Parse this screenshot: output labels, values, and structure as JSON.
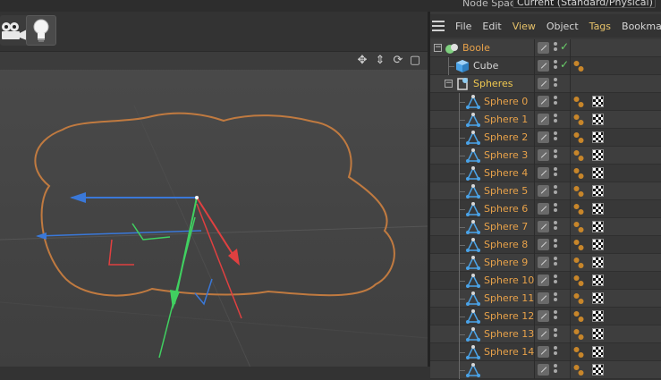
{
  "node_space": {
    "label": "Node Space:",
    "value": "Current (Standard/Physical)"
  },
  "toolbar": {
    "buttons": [
      {
        "icon": "camera-icon"
      },
      {
        "icon": "lightbulb-icon"
      }
    ]
  },
  "viewport": {
    "header_icons": [
      "move-view-icon",
      "dolly-view-icon",
      "rotate-view-icon",
      "maximize-view-icon"
    ]
  },
  "object_manager": {
    "menu": [
      "File",
      "Edit",
      "View",
      "Object",
      "Tags",
      "Bookmarks"
    ],
    "highlighted_menu": [
      "View",
      "Tags"
    ],
    "objects": [
      {
        "name": "Boole",
        "depth": 0,
        "type": "boole",
        "name_color": "#e8a24a",
        "checked": true,
        "material": false,
        "texture": false,
        "expanded": true
      },
      {
        "name": "Cube",
        "depth": 1,
        "type": "cube",
        "name_color": "#d6d6d6",
        "checked": true,
        "material": true,
        "texture": false
      },
      {
        "name": "Spheres",
        "depth": 1,
        "type": "null",
        "name_color": "#f0c850",
        "checked": false,
        "material": false,
        "texture": false,
        "expanded": true
      },
      {
        "name": "Sphere 0",
        "depth": 2,
        "type": "sphere",
        "name_color": "#e8a24a",
        "checked": false,
        "material": true,
        "texture": true
      },
      {
        "name": "Sphere 1",
        "depth": 2,
        "type": "sphere",
        "name_color": "#e8a24a",
        "checked": false,
        "material": true,
        "texture": true
      },
      {
        "name": "Sphere 2",
        "depth": 2,
        "type": "sphere",
        "name_color": "#e8a24a",
        "checked": false,
        "material": true,
        "texture": true
      },
      {
        "name": "Sphere 3",
        "depth": 2,
        "type": "sphere",
        "name_color": "#e8a24a",
        "checked": false,
        "material": true,
        "texture": true
      },
      {
        "name": "Sphere 4",
        "depth": 2,
        "type": "sphere",
        "name_color": "#e8a24a",
        "checked": false,
        "material": true,
        "texture": true
      },
      {
        "name": "Sphere 5",
        "depth": 2,
        "type": "sphere",
        "name_color": "#e8a24a",
        "checked": false,
        "material": true,
        "texture": true
      },
      {
        "name": "Sphere 6",
        "depth": 2,
        "type": "sphere",
        "name_color": "#e8a24a",
        "checked": false,
        "material": true,
        "texture": true
      },
      {
        "name": "Sphere 7",
        "depth": 2,
        "type": "sphere",
        "name_color": "#e8a24a",
        "checked": false,
        "material": true,
        "texture": true
      },
      {
        "name": "Sphere 8",
        "depth": 2,
        "type": "sphere",
        "name_color": "#e8a24a",
        "checked": false,
        "material": true,
        "texture": true
      },
      {
        "name": "Sphere 9",
        "depth": 2,
        "type": "sphere",
        "name_color": "#e8a24a",
        "checked": false,
        "material": true,
        "texture": true
      },
      {
        "name": "Sphere 10",
        "depth": 2,
        "type": "sphere",
        "name_color": "#e8a24a",
        "checked": false,
        "material": true,
        "texture": true
      },
      {
        "name": "Sphere 11",
        "depth": 2,
        "type": "sphere",
        "name_color": "#e8a24a",
        "checked": false,
        "material": true,
        "texture": true
      },
      {
        "name": "Sphere 12",
        "depth": 2,
        "type": "sphere",
        "name_color": "#e8a24a",
        "checked": false,
        "material": true,
        "texture": true
      },
      {
        "name": "Sphere 13",
        "depth": 2,
        "type": "sphere",
        "name_color": "#e8a24a",
        "checked": false,
        "material": true,
        "texture": true
      },
      {
        "name": "Sphere 14",
        "depth": 2,
        "type": "sphere",
        "name_color": "#e8a24a",
        "checked": false,
        "material": true,
        "texture": true
      },
      {
        "name": "",
        "depth": 2,
        "type": "sphere",
        "name_color": "#e8a24a",
        "checked": false,
        "material": true,
        "texture": true
      }
    ]
  },
  "colors": {
    "x_axis": "#e04040",
    "y_axis": "#40d060",
    "z_axis": "#3a78d8",
    "outline": "#c07a40",
    "accent_orange": "#e8a24a",
    "accent_yellow": "#f0c850"
  }
}
